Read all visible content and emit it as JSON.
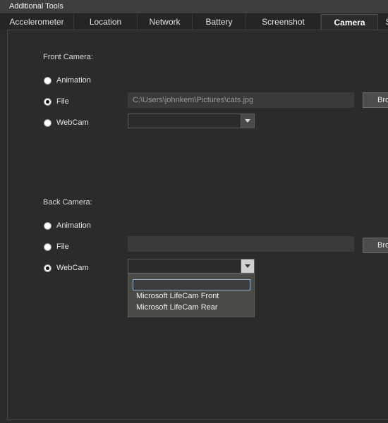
{
  "window": {
    "title": "Additional Tools"
  },
  "tabs": [
    {
      "label": "Accelerometer"
    },
    {
      "label": "Location"
    },
    {
      "label": "Network"
    },
    {
      "label": "Battery"
    },
    {
      "label": "Screenshot"
    },
    {
      "label": "Camera",
      "active": true
    },
    {
      "label": "S"
    }
  ],
  "front": {
    "heading": "Front Camera:",
    "options": [
      "Animation",
      "File",
      "WebCam"
    ],
    "selected": "File",
    "file_path": "C:\\Users\\johnkem\\Pictures\\cats.jpg",
    "browse_label": "Browse...",
    "webcam_value": ""
  },
  "back": {
    "heading": "Back Camera:",
    "options": [
      "Animation",
      "File",
      "WebCam"
    ],
    "selected": "WebCam",
    "file_path": "",
    "browse_label": "Browse...",
    "webcam_value": "",
    "webcam_dropdown_open": true,
    "webcam_options": [
      "",
      "Microsoft LifeCam Front",
      "Microsoft LifeCam Rear"
    ]
  },
  "colors": {
    "background": "#2b2b2b",
    "tab_active": "#2b2b2b",
    "focus_border": "#8fb3c9"
  }
}
